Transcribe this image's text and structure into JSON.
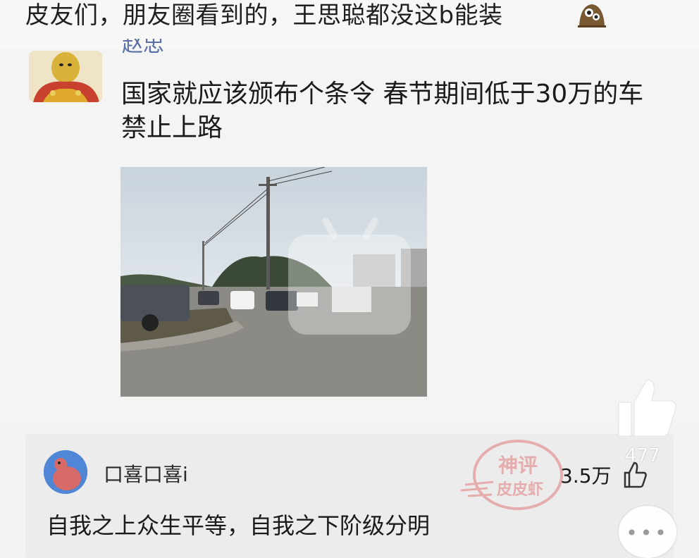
{
  "post": {
    "title": "皮友们，朋友圈看到的，王思聪都没这b能装",
    "emoji_icon": "shocked-face-icon"
  },
  "comment": {
    "username_partial": "赵忠",
    "text": "国家就应该颁布个条令 春节期间低于30万的车禁止上路",
    "image_alt": "road-traffic-photo"
  },
  "reply": {
    "username": "口喜口喜i",
    "text": "自我之上众生平等，自我之下阶级分明",
    "likes": "3.5万"
  },
  "side_actions": {
    "like_count": "477",
    "more_label": "•••"
  },
  "watermark": {
    "line1": "神评",
    "line2": "皮皮虾"
  },
  "colors": {
    "username_blue": "#5a6fa5",
    "watermark_red": "#e07a7a"
  }
}
